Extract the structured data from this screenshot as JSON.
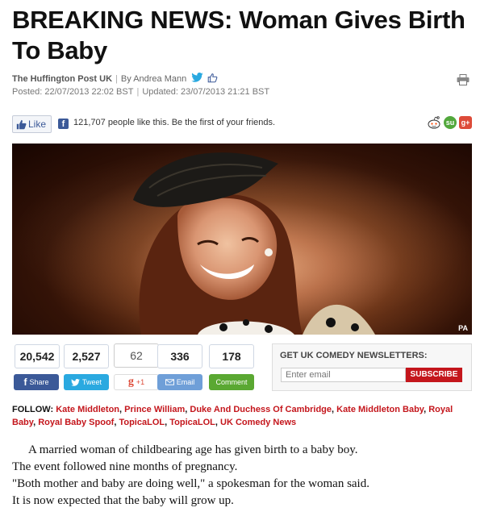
{
  "article": {
    "headline": "BREAKING NEWS: Woman Gives Birth To Baby",
    "source": "The Huffington Post UK",
    "byline": "By Andrea Mann",
    "posted": "Posted: 22/07/2013 22:02 BST",
    "updated": "Updated: 23/07/2013 21:21 BST",
    "photo_credit": "PA",
    "body": [
      "A married woman of childbearing age has given birth to a baby boy.",
      "The event followed nine months of pregnancy.",
      "\"Both mother and baby are doing well,\" a spokesman for the woman said.",
      "It is now expected that the baby will grow up."
    ]
  },
  "like_bar": {
    "like_label": "Like",
    "fb_glyph": "f",
    "text": "121,707 people like this. Be the first of your friends.",
    "stumble_label": "su",
    "gplus_label": "g+"
  },
  "share": {
    "counts": [
      {
        "value": "20,542"
      },
      {
        "value": "2,527"
      },
      {
        "value": "62"
      },
      {
        "value": "336"
      },
      {
        "value": "178"
      }
    ],
    "buttons": [
      {
        "label": "Share",
        "icon": "facebook-icon",
        "color": "#3b5998"
      },
      {
        "label": "Tweet",
        "icon": "twitter-icon",
        "color": "#2aa9e0"
      },
      {
        "label": "+1",
        "icon": "google-plus-icon",
        "color": "#ffffff"
      },
      {
        "label": "Email",
        "icon": "email-icon",
        "color": "#6f9fd8"
      },
      {
        "label": "Comment",
        "icon": "comment-icon",
        "color": "#5aa832"
      }
    ],
    "gplus_glyph": "g"
  },
  "newsletter": {
    "title": "GET UK COMEDY NEWSLETTERS:",
    "placeholder": "Enter email",
    "button": "SUBSCRIBE"
  },
  "follow": {
    "label": "FOLLOW:",
    "tags": [
      "Kate Middleton",
      "Prince William",
      "Duke And Duchess Of Cambridge",
      "Kate Middleton Baby",
      "Royal Baby",
      "Royal Baby Spoof",
      "TopicaLOL",
      "TopicaLOL",
      "UK Comedy News"
    ]
  },
  "colors": {
    "brand_red": "#c4161c",
    "facebook_blue": "#3b5998",
    "twitter_blue": "#2aa9e0"
  }
}
